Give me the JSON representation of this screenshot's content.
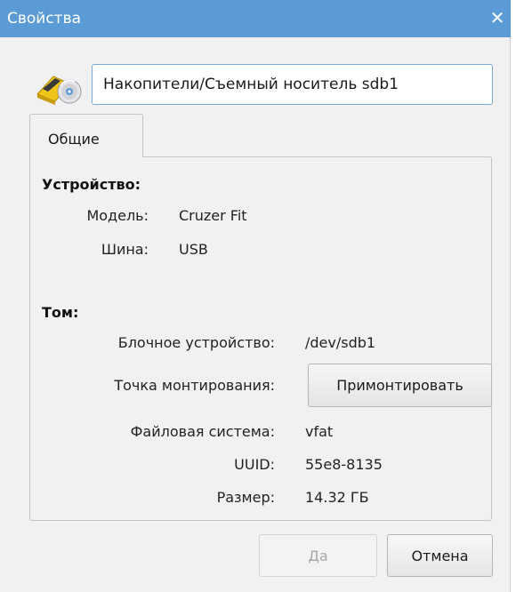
{
  "window": {
    "title": "Свойства",
    "close_glyph": "✕"
  },
  "header": {
    "icon": "removable-drive-icon",
    "name_value": "Накопители/Съемный носитель sdb1"
  },
  "tabs": [
    {
      "label": "Общие",
      "active": true
    }
  ],
  "device": {
    "heading": "Устройство:",
    "model_label": "Модель:",
    "model_value": "Cruzer Fit",
    "bus_label": "Шина:",
    "bus_value": "USB"
  },
  "volume": {
    "heading": "Том:",
    "block_device_label": "Блочное устройство:",
    "block_device_value": "/dev/sdb1",
    "mount_point_label": "Точка монтирования:",
    "mount_button_label": "Примонтировать",
    "filesystem_label": "Файловая система:",
    "filesystem_value": "vfat",
    "uuid_label": "UUID:",
    "uuid_value": "55e8-8135",
    "size_label": "Размер:",
    "size_value": "14.32 ГБ"
  },
  "buttons": {
    "ok_label": "Да",
    "ok_enabled": false,
    "cancel_label": "Отмена"
  },
  "colors": {
    "titlebar": "#5b9bd5",
    "window_bg": "#f1f1f1",
    "input_border": "#7aa7d6"
  }
}
